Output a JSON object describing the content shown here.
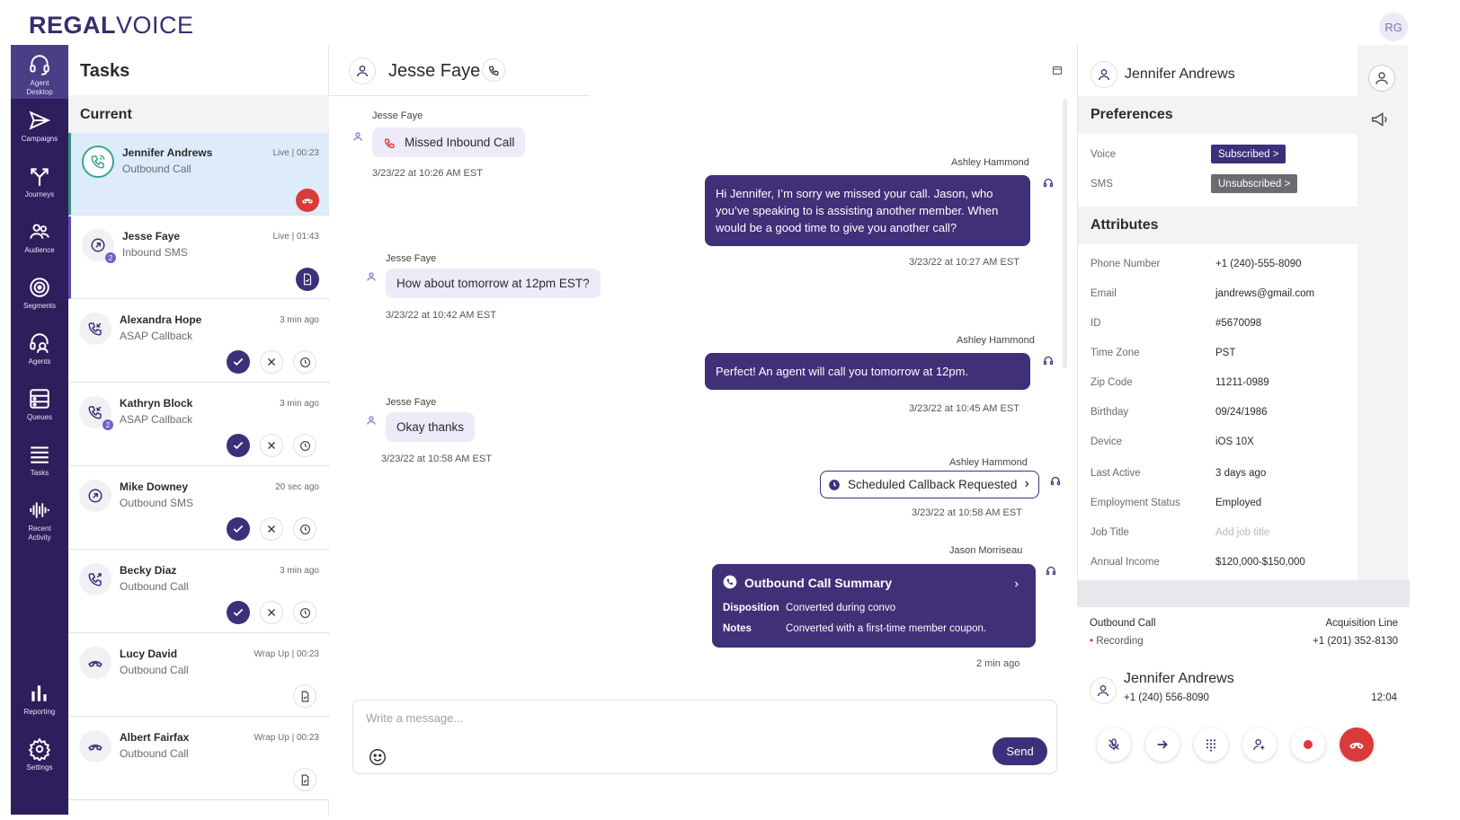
{
  "brand": {
    "logo_bold": "REGAL",
    "logo_light": "VOICE",
    "user_initials": "RG"
  },
  "nav": [
    {
      "label": "Agent\nDesktop",
      "icon": "headset-icon"
    },
    {
      "label": "Campaigns",
      "icon": "send-icon"
    },
    {
      "label": "Journeys",
      "icon": "fork-icon"
    },
    {
      "label": "Audience",
      "icon": "people-icon"
    },
    {
      "label": "Segments",
      "icon": "target-icon"
    },
    {
      "label": "Agents",
      "icon": "agent-icon"
    },
    {
      "label": "Queues",
      "icon": "queue-icon"
    },
    {
      "label": "Tasks",
      "icon": "list-icon"
    },
    {
      "label": "Recent\nActivity",
      "icon": "waveform-icon"
    },
    {
      "label": "Reporting",
      "icon": "bar-chart-icon"
    },
    {
      "label": "Settings",
      "icon": "gear-icon"
    }
  ],
  "tasks": {
    "title": "Tasks",
    "section": "Current",
    "items": [
      {
        "name": "Jennifer Andrews",
        "sub": "Outbound Call",
        "time": "Live | 00:23"
      },
      {
        "name": "Jesse Faye",
        "sub": "Inbound SMS",
        "time": "Live | 01:43",
        "badge": "2"
      },
      {
        "name": "Alexandra Hope",
        "sub": "ASAP Callback",
        "time": "3 min ago"
      },
      {
        "name": "Kathryn Block",
        "sub": "ASAP Callback",
        "time": "3 min ago",
        "badge": "2"
      },
      {
        "name": "Mike Downey",
        "sub": "Outbound SMS",
        "time": "20 sec ago"
      },
      {
        "name": "Becky Diaz",
        "sub": "Outbound Call",
        "time": "3 min ago"
      },
      {
        "name": "Lucy David",
        "sub": "Outbound Call",
        "time": "Wrap Up | 00:23"
      },
      {
        "name": "Albert Fairfax",
        "sub": "Outbound Call",
        "time": "Wrap Up | 00:23"
      }
    ]
  },
  "chat": {
    "contact": "Jesse Faye",
    "messages": {
      "m1_who": "Jesse Faye",
      "m1_text": "Missed Inbound Call",
      "m1_time": "3/23/22 at 10:26 AM EST",
      "m2_who": "Ashley Hammond",
      "m2_text": "Hi Jennifer, I’m sorry we missed your call. Jason, who you’ve speaking to is assisting another member. When would be a good time to give you another call?",
      "m2_time": "3/23/22 at 10:27 AM EST",
      "m3_who": "Jesse Faye",
      "m3_text": "How about tomorrow at 12pm EST?",
      "m3_time": "3/23/22 at 10:42 AM EST",
      "m4_who": "Ashley Hammond",
      "m4_text": "Perfect! An agent will call you tomorrow at 12pm.",
      "m4_time": "3/23/22 at 10:45 AM EST",
      "m5_who": "Jesse Faye",
      "m5_text": "Okay thanks",
      "m5_time": "3/23/22 at 10:58 AM EST",
      "m6_who": "Ashley Hammond",
      "m6_text": "Scheduled Callback Requested",
      "m6_time": "3/23/22 at 10:58 AM EST",
      "m7_who": "Jason Morriseau",
      "m7_title": "Outbound Call Summary",
      "m7_k1": "Disposition",
      "m7_v1": "Converted during convo",
      "m7_k2": "Notes",
      "m7_v2": "Converted with a first-time member  coupon.",
      "m7_time": "2 min ago"
    },
    "composer": {
      "placeholder": "Write a message...",
      "send": "Send"
    }
  },
  "profile": {
    "name": "Jennifer Andrews",
    "pref_title": "Preferences",
    "voice_label": "Voice",
    "voice_value": "Subscribed >",
    "sms_label": "SMS",
    "sms_value": "Unsubscribed >",
    "attr_title": "Attributes",
    "attributes": [
      {
        "k": "Phone Number",
        "v": "+1 (240)-555-8090"
      },
      {
        "k": "Email",
        "v": "jandrews@gmail.com"
      },
      {
        "k": "ID",
        "v": "#5670098"
      },
      {
        "k": "Time Zone",
        "v": "PST"
      },
      {
        "k": "Zip Code",
        "v": "11211-0989"
      },
      {
        "k": "Birthday",
        "v": "09/24/1986"
      },
      {
        "k": "Device",
        "v": "iOS 10X"
      },
      {
        "k": "Last Active",
        "v": "3 days ago"
      },
      {
        "k": "Employment Status",
        "v": "Employed"
      },
      {
        "k": "Job Title",
        "v": "Add job title"
      },
      {
        "k": "Annual Income",
        "v": "$120,000-$150,000"
      }
    ]
  },
  "call": {
    "type": "Outbound Call",
    "status": "Recording",
    "line_label": "Acquisition Line",
    "line_number": "+1 (201) 352-8130",
    "name": "Jennifer Andrews",
    "number": "+1 (240) 556-8090",
    "duration": "12:04"
  },
  "colors": {
    "primary": "#3e2f7a",
    "nav": "#2e1e5c",
    "hangup": "#d93a3a",
    "live": "#3ba48b"
  }
}
